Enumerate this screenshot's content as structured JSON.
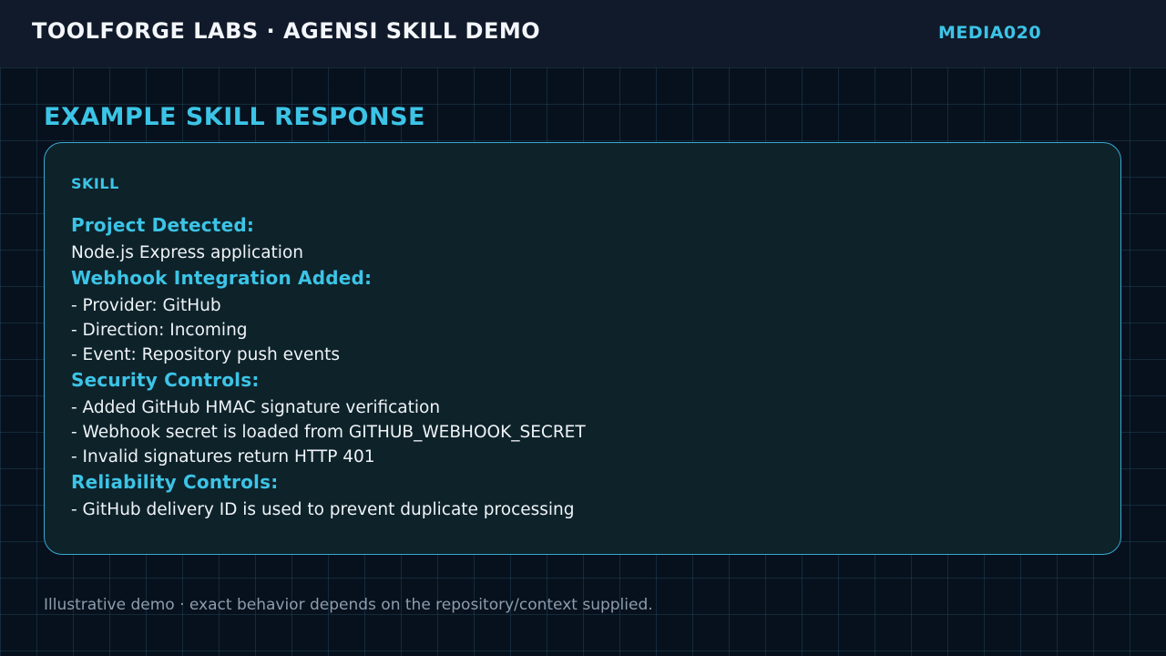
{
  "header": {
    "brand": "TOOLFORGE LABS · AGENSI SKILL DEMO",
    "media_id": "MEDIA020"
  },
  "main": {
    "heading": "EXAMPLE SKILL RESPONSE",
    "card": {
      "label": "SKILL",
      "sections": [
        {
          "title": "Project Detected:",
          "lines": [
            "Node.js Express application"
          ]
        },
        {
          "title": "Webhook Integration Added:",
          "lines": [
            "- Provider: GitHub",
            "- Direction: Incoming",
            "- Event: Repository push events"
          ]
        },
        {
          "title": "Security Controls:",
          "lines": [
            "- Added GitHub HMAC signature verification",
            "- Webhook secret is loaded from GITHUB_WEBHOOK_SECRET",
            "- Invalid signatures return HTTP 401"
          ]
        },
        {
          "title": "Reliability Controls:",
          "lines": [
            "- GitHub delivery ID is used to prevent duplicate processing"
          ]
        }
      ]
    }
  },
  "footer": {
    "note": "Illustrative demo · exact behavior depends on the repository/context supplied."
  },
  "colors": {
    "accent": "#3cc4e6",
    "background": "#07111d",
    "header_bg": "#111a2a",
    "card_bg": "#0e222a",
    "card_border": "#3aa9cf",
    "body_text": "#eef3f6",
    "muted_text": "#8e9cad"
  }
}
